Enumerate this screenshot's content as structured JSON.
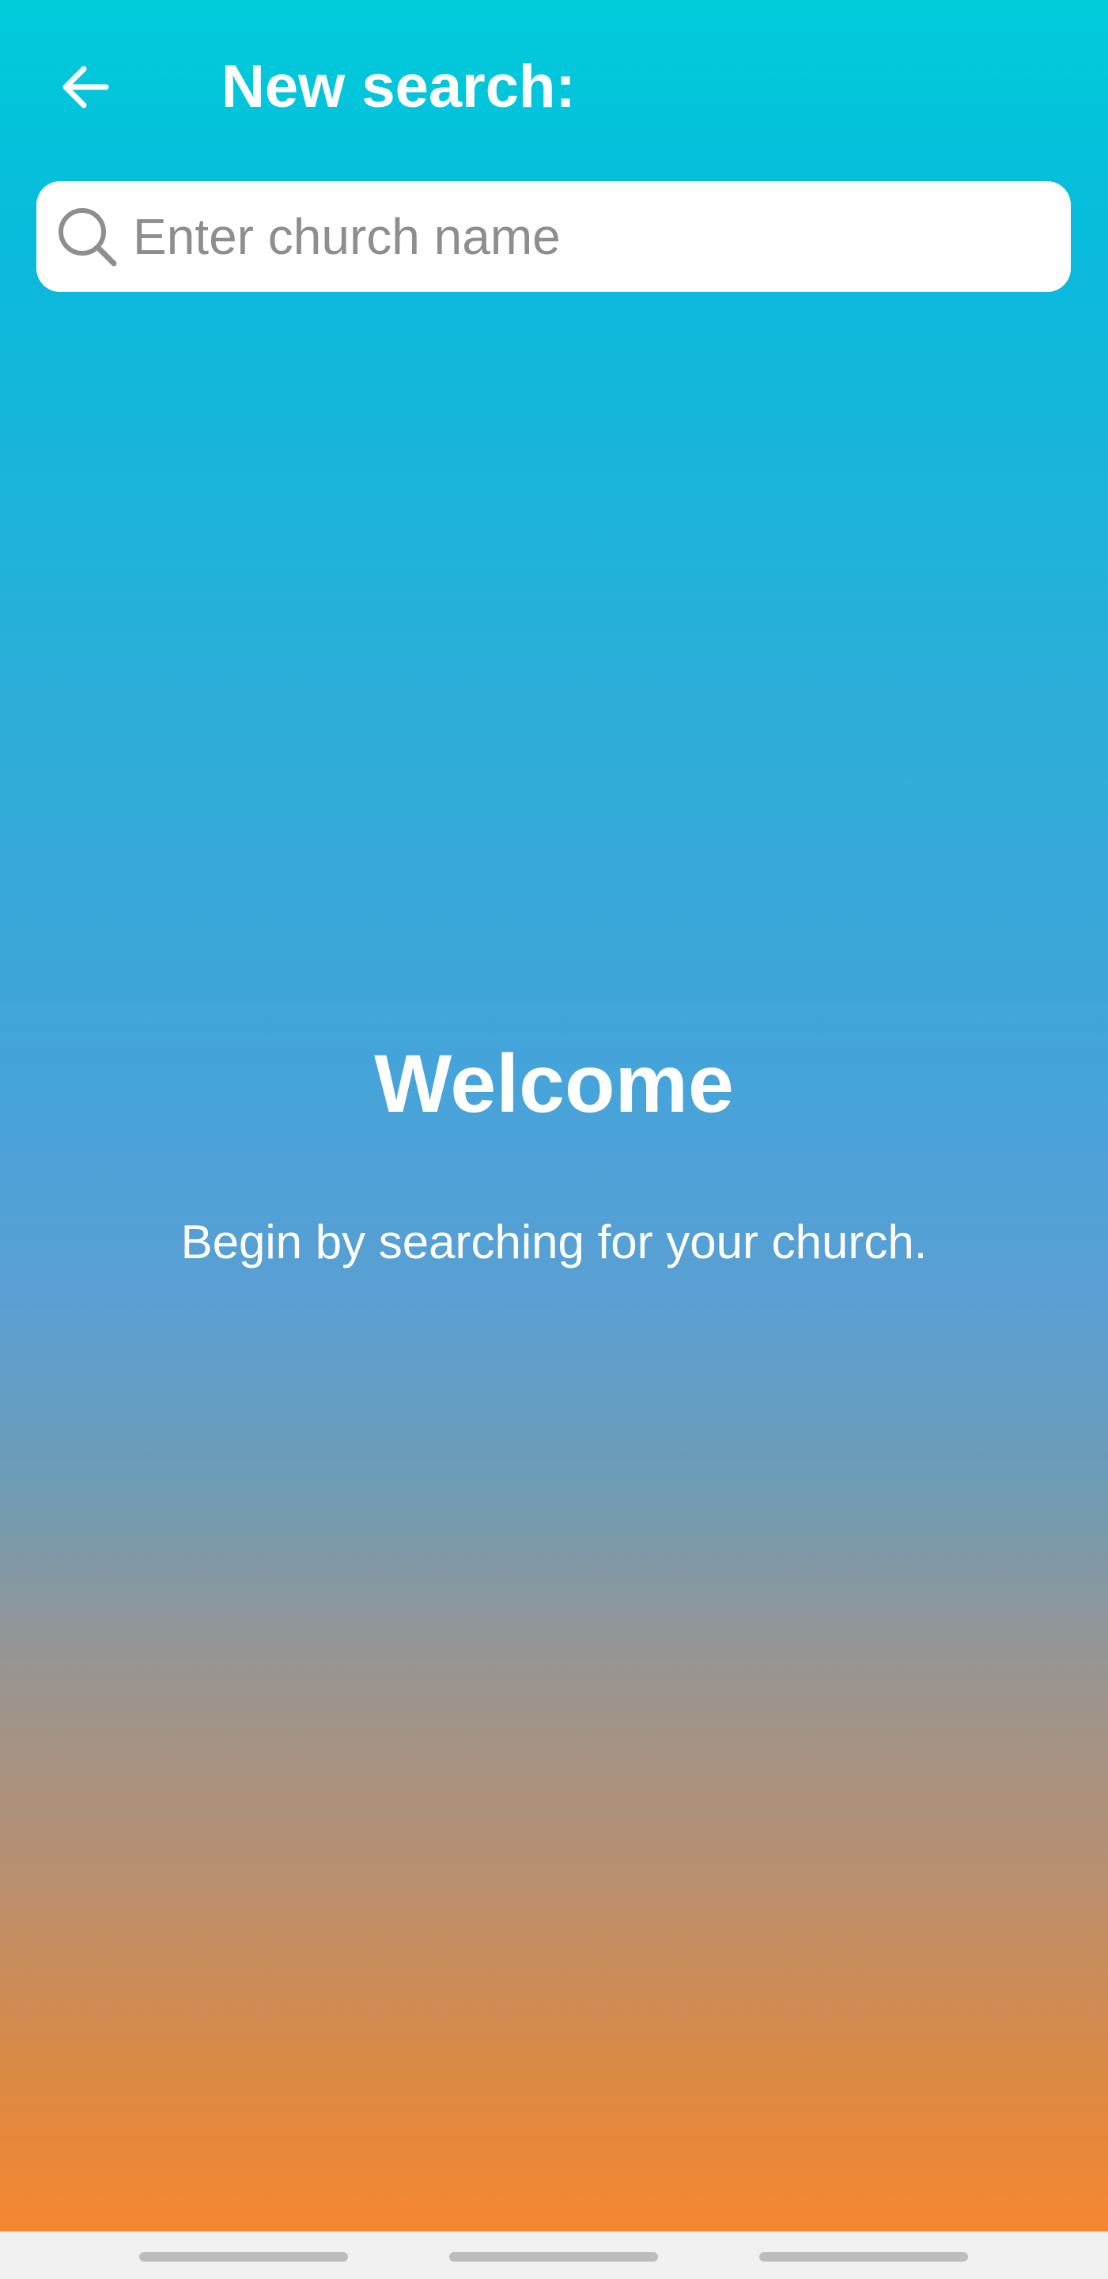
{
  "header": {
    "back_icon": "arrow-left-icon",
    "title": "New search:"
  },
  "search": {
    "icon": "search-icon",
    "placeholder": "Enter church name",
    "value": ""
  },
  "main": {
    "welcome_title": "Welcome",
    "welcome_subtitle": "Begin by searching for your church."
  },
  "colors": {
    "gradient_top": "#00CCDA",
    "gradient_middle": "#45A4DA",
    "gradient_bottom": "#F58730",
    "text": "#FFFFFF",
    "search_background": "#FFFFFF",
    "placeholder": "#8E8E8E"
  },
  "system_nav": {
    "handles": [
      "nav-handle",
      "nav-handle",
      "nav-handle"
    ]
  }
}
